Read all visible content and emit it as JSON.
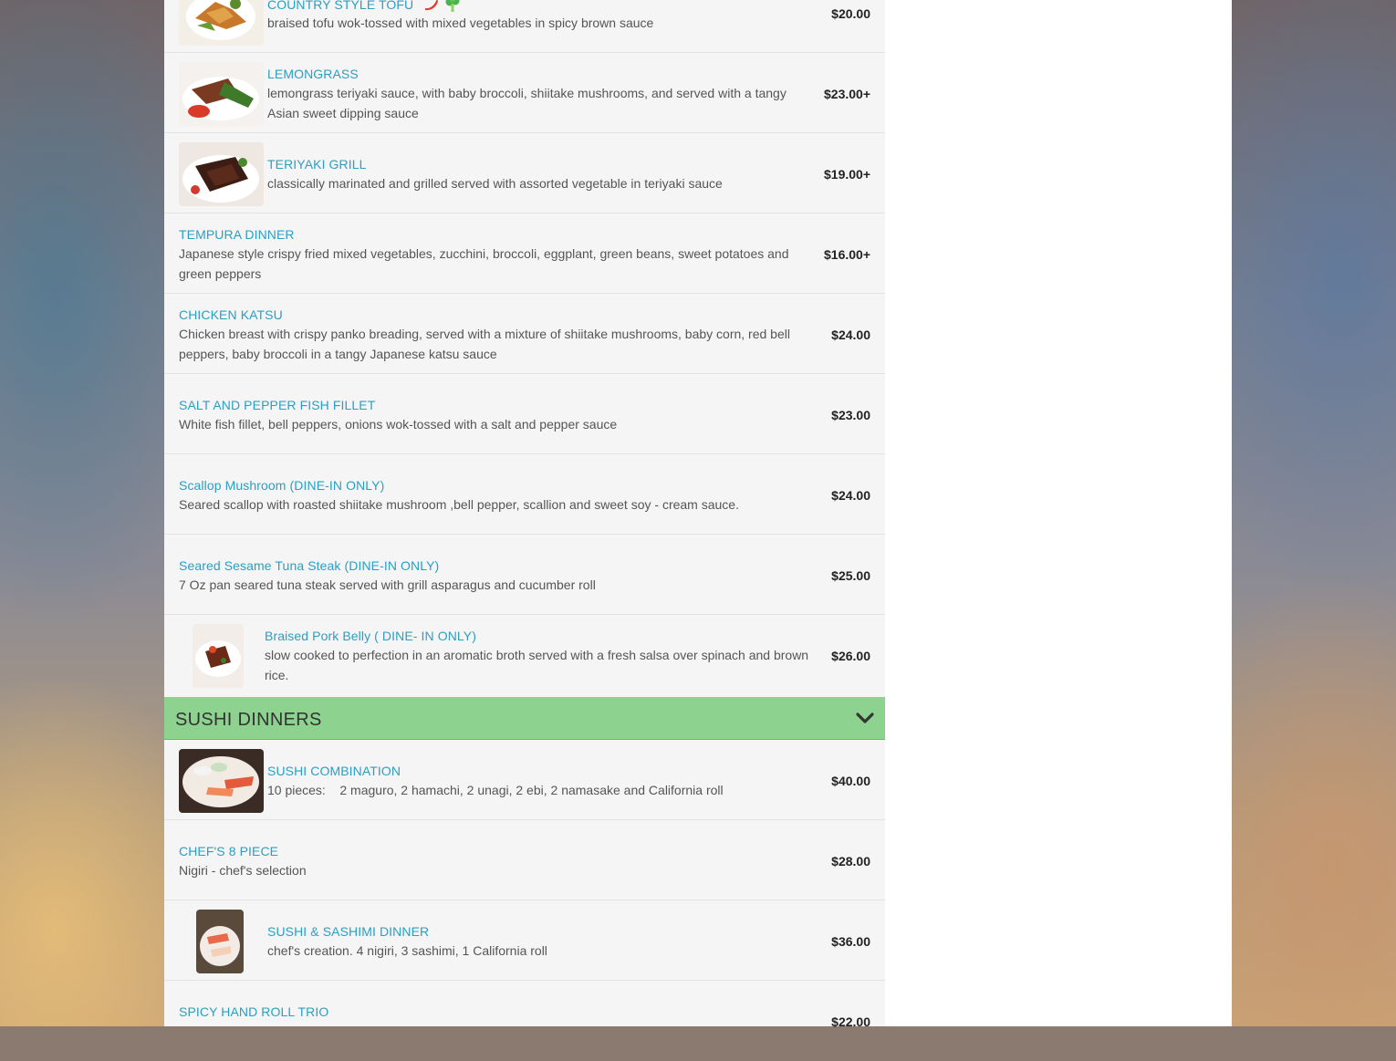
{
  "items_top": [
    {
      "name": "COUNTRY STYLE TOFU",
      "desc": "braised tofu wok-tossed with mixed vegetables in spicy brown sauce",
      "price": "$20.00"
    },
    {
      "name": "LEMONGRASS",
      "desc": "lemongrass teriyaki sauce, with baby broccoli, shiitake mushrooms, and served with a tangy Asian sweet dipping sauce",
      "price": "$23.00+"
    },
    {
      "name": "TERIYAKI GRILL",
      "desc": "classically marinated and grilled served with assorted vegetable in teriyaki sauce",
      "price": "$19.00+"
    },
    {
      "name": "TEMPURA DINNER",
      "desc": "Japanese style crispy fried mixed vegetables, zucchini, broccoli, eggplant, green beans, sweet potatoes and green peppers",
      "price": "$16.00+"
    },
    {
      "name": "CHICKEN KATSU",
      "desc": "Chicken breast with crispy panko breading, served with a mixture of shiitake mushrooms, baby corn, red bell peppers, baby broccoli in a tangy Japanese katsu sauce",
      "price": "$24.00"
    },
    {
      "name": "SALT AND PEPPER FISH FILLET",
      "desc": "White fish fillet, bell peppers, onions wok-tossed with a salt and pepper sauce",
      "price": "$23.00"
    },
    {
      "name": "Scallop Mushroom (DINE-IN ONLY)",
      "desc": "Seared scallop with roasted shiitake mushroom ,bell pepper, scallion and sweet soy - cream sauce.",
      "price": "$24.00"
    },
    {
      "name": "Seared Sesame Tuna Steak (DINE-IN ONLY)",
      "desc": "7 Oz pan seared tuna steak served with grill asparagus and cucumber roll",
      "price": "$25.00"
    },
    {
      "name": "Braised Pork Belly ( DINE- IN ONLY)",
      "desc": "slow cooked to perfection in an aromatic broth served with a fresh salsa over spinach and brown rice.",
      "price": "$26.00"
    }
  ],
  "category": {
    "title": "SUSHI DINNERS",
    "icon": "chevron-down-icon",
    "color": "#8dd28e"
  },
  "items_sushi": [
    {
      "name": "SUSHI COMBINATION",
      "desc": "10 pieces:    2 maguro, 2 hamachi, 2 unagi, 2 ebi, 2 namasake and California roll",
      "price": "$40.00"
    },
    {
      "name": "CHEF'S 8 PIECE",
      "desc": "Nigiri - chef's selection",
      "price": "$28.00"
    },
    {
      "name": "SUSHI & SASHIMI DINNER",
      "desc": "chef's creation. 4 nigiri, 3 sashimi, 1 California roll",
      "price": "$36.00"
    },
    {
      "name": "SPICY HAND ROLL TRIO",
      "desc": "",
      "price": "$22.00"
    }
  ],
  "colors": {
    "item_name": "#2a9fc4",
    "category_bg": "#8dd28e"
  }
}
